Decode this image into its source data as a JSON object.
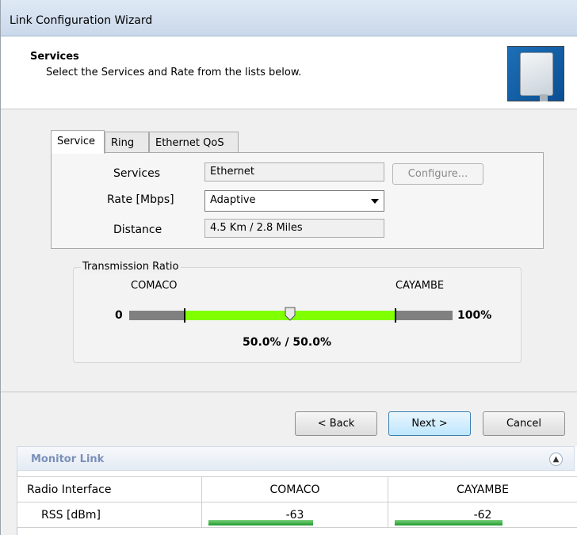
{
  "window": {
    "title": "Link Configuration Wizard"
  },
  "header": {
    "title": "Services",
    "subtitle": "Select the Services and Rate from the lists below.",
    "icon": "radio-panel-icon"
  },
  "tabs": [
    {
      "label": "Service",
      "active": true
    },
    {
      "label": "Ring",
      "active": false
    },
    {
      "label": "Ethernet QoS",
      "active": false
    }
  ],
  "service": {
    "services_label": "Services",
    "services_value": "Ethernet",
    "configure_label": "Configure...",
    "rate_label": "Rate [Mbps]",
    "rate_value": "Adaptive",
    "distance_label": "Distance",
    "distance_value": "4.5 Km / 2.8 Miles"
  },
  "transmission": {
    "title": "Transmission Ratio",
    "left_site": "COMACO",
    "right_site": "CAYAMBE",
    "min_label": "0",
    "max_label": "100%",
    "ratio_text": "50.0% / 50.0%",
    "ratio_value": 0.5
  },
  "buttons": {
    "back": "< Back",
    "next": "Next >",
    "cancel": "Cancel"
  },
  "monitor": {
    "title": "Monitor Link",
    "columns": [
      "Radio Interface",
      "COMACO",
      "CAYAMBE"
    ],
    "rows": [
      {
        "label": "RSS [dBm]",
        "values": [
          "-63",
          "-62"
        ]
      }
    ]
  },
  "colors": {
    "accent_green": "#7fff00",
    "bar_gray": "#808080",
    "rss_green": "#1e9a2e"
  }
}
